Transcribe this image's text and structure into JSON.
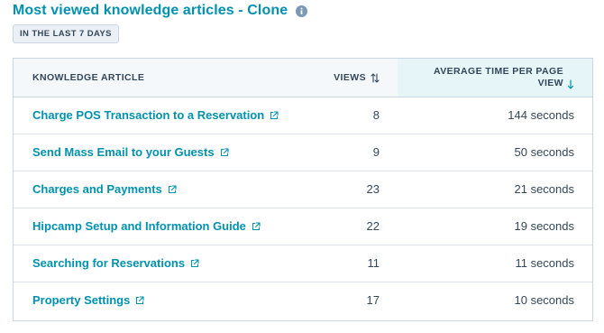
{
  "header": {
    "title": "Most viewed knowledge articles - Clone",
    "info_icon": "info-icon"
  },
  "badge": {
    "label": "IN THE LAST 7 DAYS"
  },
  "table": {
    "columns": {
      "article": "KNOWLEDGE ARTICLE",
      "views": "VIEWS",
      "avg": "AVERAGE TIME PER PAGE VIEW"
    },
    "sort": {
      "views_icon": "sort-icon",
      "avg_icon": "arrow-down-icon",
      "active_column": "avg"
    },
    "rows": [
      {
        "title": "Charge POS Transaction to a Reservation",
        "views": "8",
        "avg": "144 seconds"
      },
      {
        "title": "Send Mass Email to your Guests",
        "views": "9",
        "avg": "50 seconds"
      },
      {
        "title": "Charges and Payments",
        "views": "23",
        "avg": "21 seconds"
      },
      {
        "title": "Hipcamp Setup and Information Guide",
        "views": "22",
        "avg": "19 seconds"
      },
      {
        "title": "Searching for Reservations",
        "views": "11",
        "avg": "11 seconds"
      },
      {
        "title": "Property Settings",
        "views": "17",
        "avg": "10 seconds"
      }
    ],
    "link_icon": "external-link-icon"
  },
  "colors": {
    "accent": "#0091ae",
    "text": "#33475b",
    "header_bg": "#f5f8fa",
    "active_header_bg": "#e5f5f8",
    "border": "#cbd6e2"
  }
}
